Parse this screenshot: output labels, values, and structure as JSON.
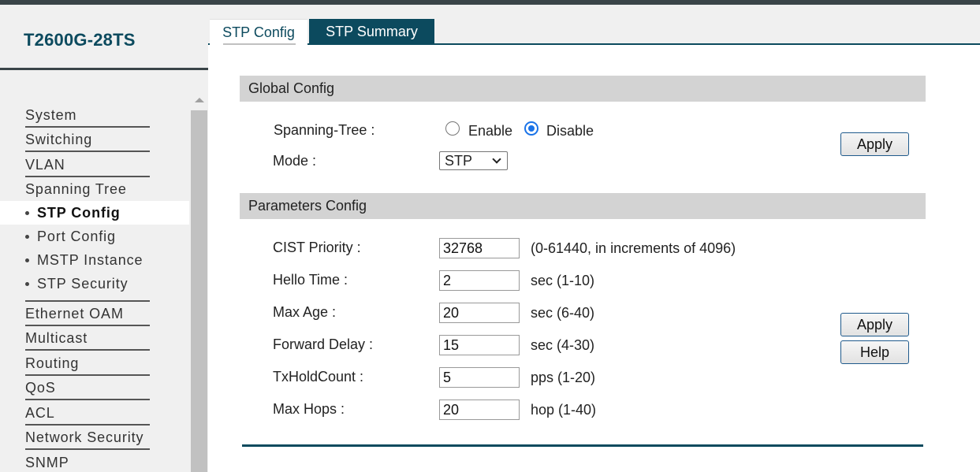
{
  "device": {
    "model": "T2600G-28TS"
  },
  "menu": {
    "top_items": [
      {
        "label": "System"
      },
      {
        "label": "Switching"
      },
      {
        "label": "VLAN"
      },
      {
        "label": "Spanning Tree"
      }
    ],
    "sub_items": [
      {
        "label": "STP Config",
        "active": true
      },
      {
        "label": "Port Config"
      },
      {
        "label": "MSTP Instance"
      },
      {
        "label": "STP Security"
      }
    ],
    "bottom_items": [
      {
        "label": "Ethernet OAM"
      },
      {
        "label": "Multicast"
      },
      {
        "label": "Routing"
      },
      {
        "label": "QoS"
      },
      {
        "label": "ACL"
      },
      {
        "label": "Network Security"
      },
      {
        "label": "SNMP"
      }
    ]
  },
  "tabs": [
    {
      "label": "STP Config",
      "active": false
    },
    {
      "label": "STP Summary",
      "active": true
    }
  ],
  "global_config": {
    "title": "Global Config",
    "spanning_tree_label": "Spanning-Tree :",
    "enable_label": "Enable",
    "disable_label": "Disable",
    "selected": "Disable",
    "mode_label": "Mode :",
    "mode_value": "STP",
    "apply_label": "Apply"
  },
  "parameters_config": {
    "title": "Parameters Config",
    "fields": [
      {
        "label": "CIST Priority :",
        "value": "32768",
        "hint": "(0-61440, in increments of 4096)"
      },
      {
        "label": "Hello Time :",
        "value": "2",
        "hint": "sec (1-10)"
      },
      {
        "label": "Max Age :",
        "value": "20",
        "hint": "sec (6-40)"
      },
      {
        "label": "Forward Delay :",
        "value": "15",
        "hint": "sec (4-30)"
      },
      {
        "label": "TxHoldCount :",
        "value": "5",
        "hint": "pps (1-20)"
      },
      {
        "label": "Max Hops :",
        "value": "20",
        "hint": "hop (1-40)"
      }
    ],
    "apply_label": "Apply",
    "help_label": "Help"
  },
  "colors": {
    "brand": "#0c4a5e",
    "section_header": "#d3d3d3",
    "radio_accent": "#1a73e8"
  }
}
